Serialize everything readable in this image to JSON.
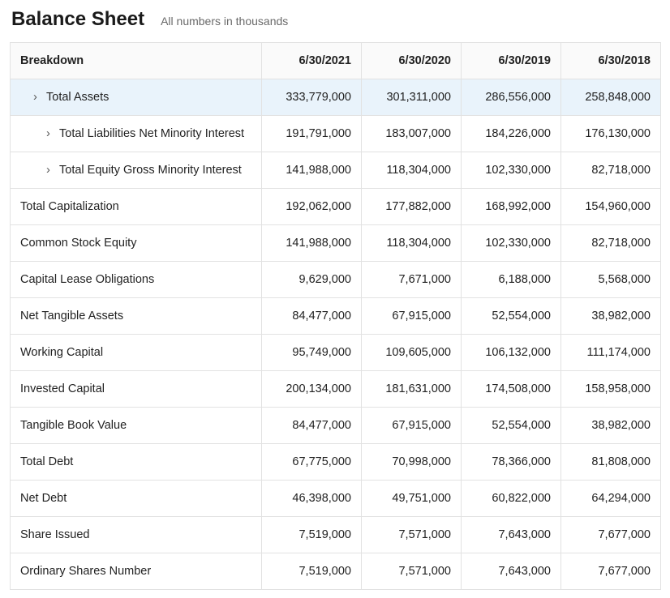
{
  "header": {
    "title": "Balance Sheet",
    "subtitle": "All numbers in thousands"
  },
  "columns": {
    "breakdown": "Breakdown",
    "d0": "6/30/2021",
    "d1": "6/30/2020",
    "d2": "6/30/2019",
    "d3": "6/30/2018"
  },
  "chevron": "›",
  "rows": [
    {
      "label": "Total Assets",
      "expandable": true,
      "indent": 1,
      "highlight": true,
      "v": [
        "333,779,000",
        "301,311,000",
        "286,556,000",
        "258,848,000"
      ]
    },
    {
      "label": "Total Liabilities Net Minority Interest",
      "expandable": true,
      "indent": 2,
      "highlight": false,
      "v": [
        "191,791,000",
        "183,007,000",
        "184,226,000",
        "176,130,000"
      ]
    },
    {
      "label": "Total Equity Gross Minority Interest",
      "expandable": true,
      "indent": 2,
      "highlight": false,
      "v": [
        "141,988,000",
        "118,304,000",
        "102,330,000",
        "82,718,000"
      ]
    },
    {
      "label": "Total Capitalization",
      "expandable": false,
      "indent": 0,
      "highlight": false,
      "v": [
        "192,062,000",
        "177,882,000",
        "168,992,000",
        "154,960,000"
      ]
    },
    {
      "label": "Common Stock Equity",
      "expandable": false,
      "indent": 0,
      "highlight": false,
      "v": [
        "141,988,000",
        "118,304,000",
        "102,330,000",
        "82,718,000"
      ]
    },
    {
      "label": "Capital Lease Obligations",
      "expandable": false,
      "indent": 0,
      "highlight": false,
      "v": [
        "9,629,000",
        "7,671,000",
        "6,188,000",
        "5,568,000"
      ]
    },
    {
      "label": "Net Tangible Assets",
      "expandable": false,
      "indent": 0,
      "highlight": false,
      "v": [
        "84,477,000",
        "67,915,000",
        "52,554,000",
        "38,982,000"
      ]
    },
    {
      "label": "Working Capital",
      "expandable": false,
      "indent": 0,
      "highlight": false,
      "v": [
        "95,749,000",
        "109,605,000",
        "106,132,000",
        "111,174,000"
      ]
    },
    {
      "label": "Invested Capital",
      "expandable": false,
      "indent": 0,
      "highlight": false,
      "v": [
        "200,134,000",
        "181,631,000",
        "174,508,000",
        "158,958,000"
      ]
    },
    {
      "label": "Tangible Book Value",
      "expandable": false,
      "indent": 0,
      "highlight": false,
      "v": [
        "84,477,000",
        "67,915,000",
        "52,554,000",
        "38,982,000"
      ]
    },
    {
      "label": "Total Debt",
      "expandable": false,
      "indent": 0,
      "highlight": false,
      "v": [
        "67,775,000",
        "70,998,000",
        "78,366,000",
        "81,808,000"
      ]
    },
    {
      "label": "Net Debt",
      "expandable": false,
      "indent": 0,
      "highlight": false,
      "v": [
        "46,398,000",
        "49,751,000",
        "60,822,000",
        "64,294,000"
      ]
    },
    {
      "label": "Share Issued",
      "expandable": false,
      "indent": 0,
      "highlight": false,
      "v": [
        "7,519,000",
        "7,571,000",
        "7,643,000",
        "7,677,000"
      ]
    },
    {
      "label": "Ordinary Shares Number",
      "expandable": false,
      "indent": 0,
      "highlight": false,
      "v": [
        "7,519,000",
        "7,571,000",
        "7,643,000",
        "7,677,000"
      ]
    }
  ],
  "chart_data": {
    "type": "table",
    "title": "Balance Sheet",
    "note": "All numbers in thousands",
    "columns": [
      "6/30/2021",
      "6/30/2020",
      "6/30/2019",
      "6/30/2018"
    ],
    "rows": [
      {
        "metric": "Total Assets",
        "values": [
          333779000,
          301311000,
          286556000,
          258848000
        ]
      },
      {
        "metric": "Total Liabilities Net Minority Interest",
        "values": [
          191791000,
          183007000,
          184226000,
          176130000
        ]
      },
      {
        "metric": "Total Equity Gross Minority Interest",
        "values": [
          141988000,
          118304000,
          102330000,
          82718000
        ]
      },
      {
        "metric": "Total Capitalization",
        "values": [
          192062000,
          177882000,
          168992000,
          154960000
        ]
      },
      {
        "metric": "Common Stock Equity",
        "values": [
          141988000,
          118304000,
          102330000,
          82718000
        ]
      },
      {
        "metric": "Capital Lease Obligations",
        "values": [
          9629000,
          7671000,
          6188000,
          5568000
        ]
      },
      {
        "metric": "Net Tangible Assets",
        "values": [
          84477000,
          67915000,
          52554000,
          38982000
        ]
      },
      {
        "metric": "Working Capital",
        "values": [
          95749000,
          109605000,
          106132000,
          111174000
        ]
      },
      {
        "metric": "Invested Capital",
        "values": [
          200134000,
          181631000,
          174508000,
          158958000
        ]
      },
      {
        "metric": "Tangible Book Value",
        "values": [
          84477000,
          67915000,
          52554000,
          38982000
        ]
      },
      {
        "metric": "Total Debt",
        "values": [
          67775000,
          70998000,
          78366000,
          81808000
        ]
      },
      {
        "metric": "Net Debt",
        "values": [
          46398000,
          49751000,
          60822000,
          64294000
        ]
      },
      {
        "metric": "Share Issued",
        "values": [
          7519000,
          7571000,
          7643000,
          7677000
        ]
      },
      {
        "metric": "Ordinary Shares Number",
        "values": [
          7519000,
          7571000,
          7643000,
          7677000
        ]
      }
    ]
  }
}
